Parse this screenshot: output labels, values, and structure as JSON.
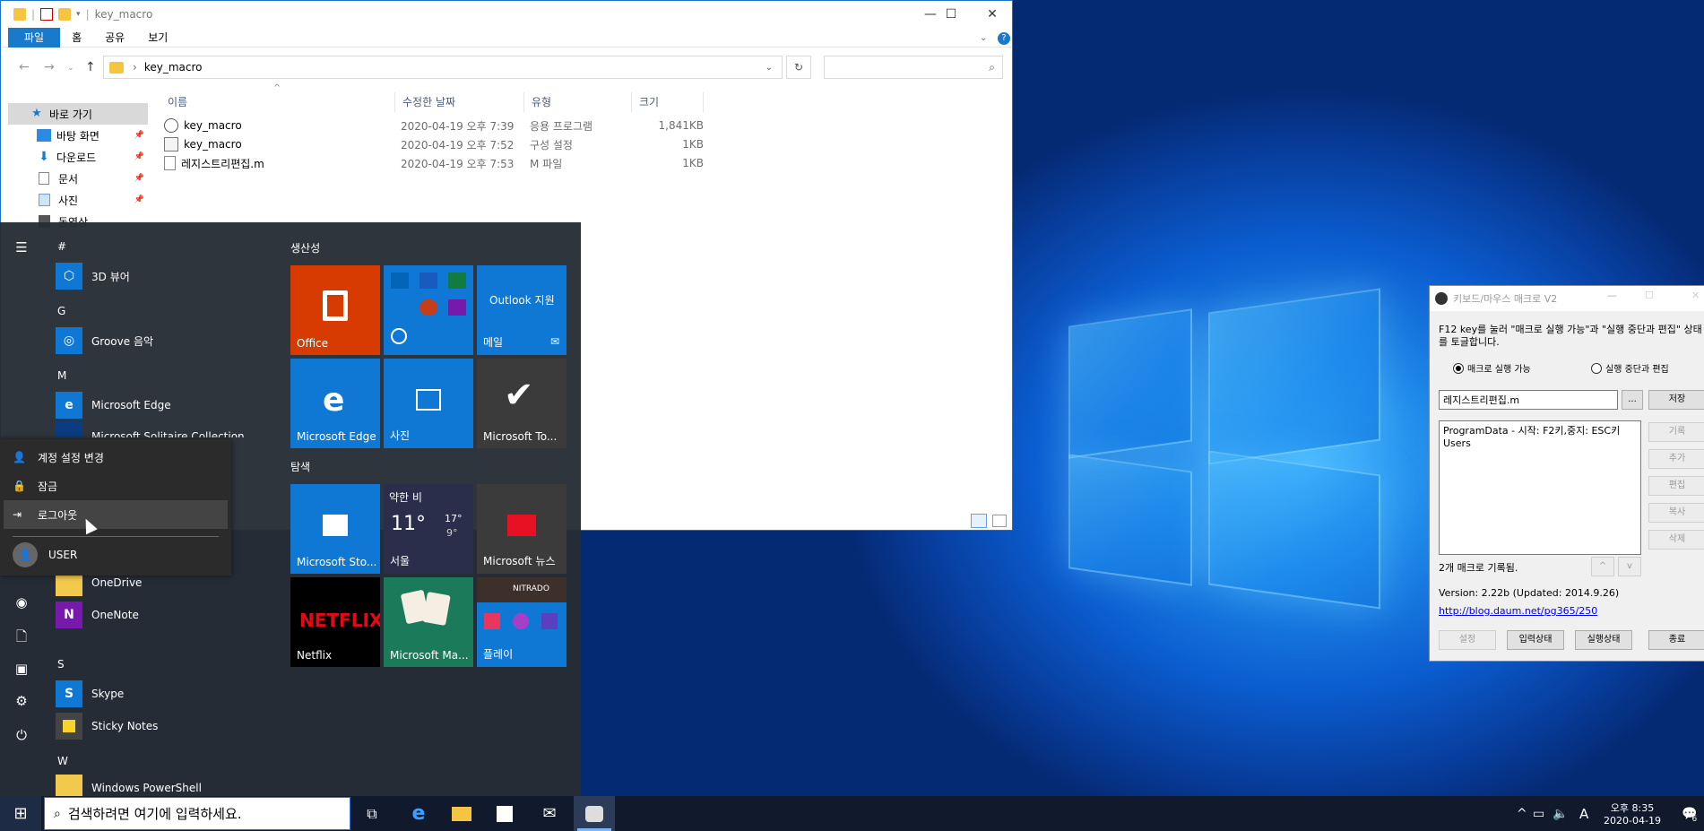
{
  "explorer": {
    "title": "key_macro",
    "ribbon_tabs": [
      "파일",
      "홈",
      "공유",
      "보기"
    ],
    "address_path": "key_macro",
    "address_separator": "›",
    "columns": [
      "이름",
      "수정한 날짜",
      "유형",
      "크기"
    ],
    "tree": [
      {
        "label": "바로 가기",
        "icon": "star-icon"
      },
      {
        "label": "바탕 화면",
        "icon": "desktop-icon"
      },
      {
        "label": "다운로드",
        "icon": "download-icon"
      },
      {
        "label": "문서",
        "icon": "document-icon"
      },
      {
        "label": "사진",
        "icon": "picture-icon"
      },
      {
        "label": "동영상",
        "icon": "video-icon"
      }
    ],
    "files": [
      {
        "name": "key_macro",
        "date": "2020-04-19 오후 7:39",
        "type": "응용 프로그램",
        "size": "1,841KB",
        "icon": "app-icon"
      },
      {
        "name": "key_macro",
        "date": "2020-04-19 오후 7:52",
        "type": "구성 설정",
        "size": "1KB",
        "icon": "config-icon"
      },
      {
        "name": "레지스트리편집.m",
        "date": "2020-04-19 오후 7:53",
        "type": "M 파일",
        "size": "1KB",
        "icon": "file-icon"
      }
    ]
  },
  "start": {
    "letters": {
      "hash": "#",
      "g": "G",
      "m": "M",
      "s": "S",
      "w": "W"
    },
    "apps": {
      "viewer3d": "3D 뷰어",
      "groove": "Groove 음악",
      "edge": "Microsoft Edge",
      "solitaire": "Microsoft Solitaire Collection",
      "onedrive": "OneDrive",
      "onenote": "OneNote",
      "skype": "Skype",
      "sticky": "Sticky Notes",
      "powershell": "Windows PowerShell"
    },
    "groups": {
      "productivity": "생산성",
      "explore": "탐색"
    },
    "tiles": {
      "office": "Office",
      "outlook_title": "Outlook 지원",
      "mail": "메일",
      "edge": "Microsoft Edge",
      "photos": "사진",
      "todo": "Microsoft To...",
      "store": "Microsoft Sto...",
      "weather_cond": "약한 비",
      "weather_temp": "11°",
      "weather_hi": "17°",
      "weather_lo": "9°",
      "weather_city": "서울",
      "news": "Microsoft 뉴스",
      "netflix_logo": "NETFLIX",
      "netflix": "Netflix",
      "mahjong": "Microsoft Ma...",
      "play": "플레이",
      "play_brand": "NITRADO"
    },
    "account_menu": {
      "change": "계정 설정 변경",
      "lock": "잠금",
      "signout": "로그아웃",
      "user": "USER"
    }
  },
  "taskbar": {
    "search_placeholder": "검색하려면 여기에 입력하세요.",
    "time": "오후 8:35",
    "date": "2020-04-19",
    "ime": "A",
    "notif_count": "6"
  },
  "macro": {
    "title": "키보드/마우스 매크로 V2",
    "desc": "F12 key를 눌러 \"매크로 실행 가능\"과 \"실행 중단과 편집\" 상태를 토글합니다.",
    "radio_run": "매크로 실행 가능",
    "radio_edit": "실행 중단과 편집",
    "file_value": "레지스트리편집.m",
    "browse": "...",
    "save": "저장",
    "macro_list": [
      "ProgramData - 시작: F2키,중지: ESC키",
      "Users"
    ],
    "side_buttons": [
      "기록",
      "추가",
      "편집",
      "복사",
      "삭제"
    ],
    "count": "2개 매크로 기록됨.",
    "up": "^",
    "down": "v",
    "version": "Version: 2.22b (Updated: 2014.9.26)",
    "link": "http://blog.daum.net/pg365/250",
    "btn_settings": "설정",
    "btn_input": "입력상태",
    "btn_run": "실행상태",
    "btn_exit": "종료"
  }
}
